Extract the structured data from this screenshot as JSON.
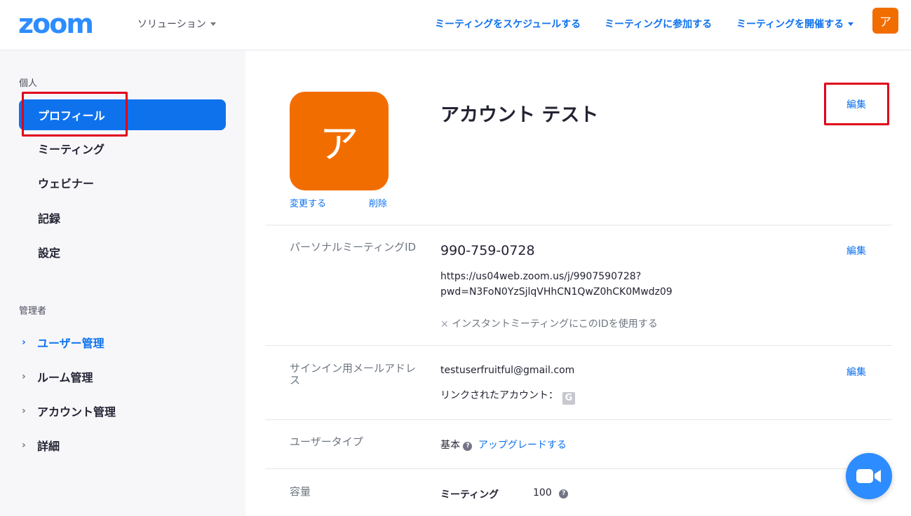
{
  "header": {
    "logo": "zoom",
    "solutions": "ソリューション",
    "nav": [
      {
        "label": "ミーティングをスケジュールする"
      },
      {
        "label": "ミーティングに参加する"
      },
      {
        "label": "ミーティングを開催する"
      }
    ],
    "avatar": "ア"
  },
  "sidebar": {
    "personal_label": "個人",
    "items": [
      {
        "label": "プロフィール"
      },
      {
        "label": "ミーティング"
      },
      {
        "label": "ウェビナー"
      },
      {
        "label": "記録"
      },
      {
        "label": "設定"
      }
    ],
    "admin_label": "管理者",
    "admin_items": [
      {
        "label": "ユーザー管理"
      },
      {
        "label": "ルーム管理"
      },
      {
        "label": "アカウント管理"
      },
      {
        "label": "詳細"
      }
    ]
  },
  "profile": {
    "avatar_letter": "ア",
    "change_link": "変更する",
    "delete_link": "削除",
    "name": "アカウント テスト",
    "edit": "編集"
  },
  "pmi": {
    "label": "パーソナルミーティングID",
    "id": "990-759-0728",
    "url_line1": "https://us04web.zoom.us/j/9907590728?",
    "url_line2": "pwd=N3FoN0YzSjlqVHhCN1QwZ0hCK0Mwdz09",
    "instant_mark": "×",
    "instant_text": "インスタントミーティングにこのIDを使用する",
    "edit": "編集"
  },
  "email": {
    "label": "サインイン用メールアドレス",
    "value": "testuserfruitful@gmail.com",
    "linked_label": "リンクされたアカウント：",
    "linked_icon": "G",
    "edit": "編集"
  },
  "usertype": {
    "label": "ユーザータイプ",
    "value": "基本",
    "help": "?",
    "upgrade": "アップグレードする"
  },
  "capacity": {
    "label": "容量",
    "meeting_label": "ミーティング",
    "meeting_value": "100",
    "help": "?"
  },
  "colors": {
    "brand_blue": "#0e72ed",
    "avatar_orange": "#f26d00",
    "highlight_red": "#e0001b"
  }
}
